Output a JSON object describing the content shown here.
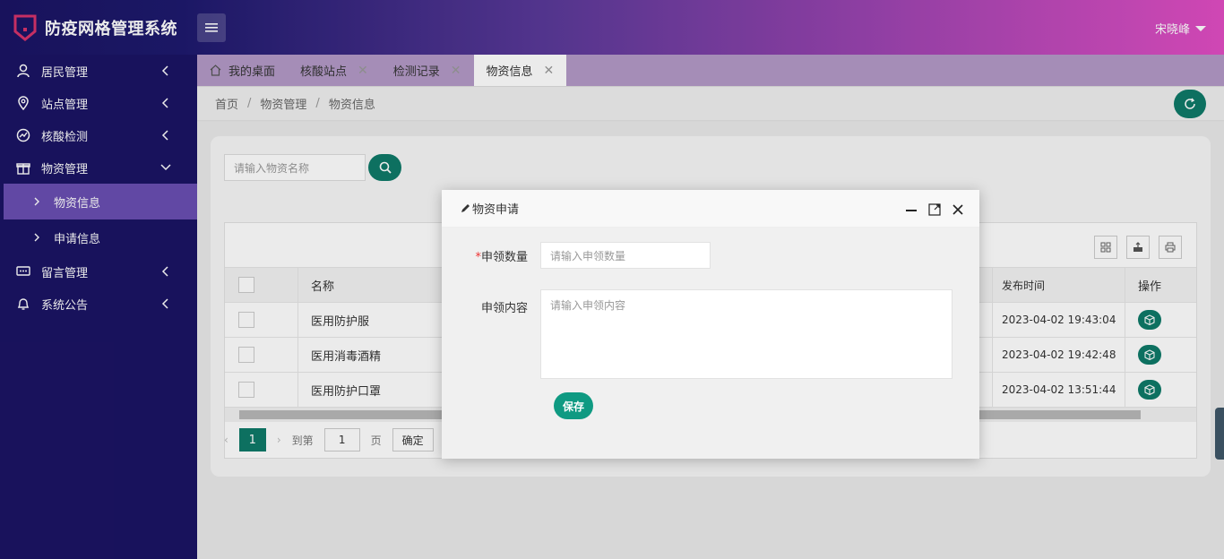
{
  "app": {
    "title": "防疫网格管理系统",
    "user": "宋晓峰"
  },
  "colors": {
    "primary": "#0f7a69",
    "sidebar": "#1b1464",
    "active_menu": "#6a4fb2"
  },
  "sidebar": {
    "items": [
      {
        "label": "居民管理",
        "icon": "user-icon"
      },
      {
        "label": "站点管理",
        "icon": "location-icon"
      },
      {
        "label": "核酸检测",
        "icon": "chart-icon"
      },
      {
        "label": "物资管理",
        "icon": "gift-icon"
      },
      {
        "label": "留言管理",
        "icon": "message-icon"
      },
      {
        "label": "系统公告",
        "icon": "bell-icon"
      }
    ],
    "sub_items": [
      {
        "label": "物资信息"
      },
      {
        "label": "申请信息"
      }
    ]
  },
  "tabs": [
    {
      "label": "我的桌面"
    },
    {
      "label": "核酸站点"
    },
    {
      "label": "检测记录"
    },
    {
      "label": "物资信息"
    }
  ],
  "breadcrumb": [
    "首页",
    "物资管理",
    "物资信息"
  ],
  "search": {
    "placeholder": "请输入物资名称"
  },
  "table": {
    "headers": {
      "name": "名称",
      "time": "发布时间",
      "op": "操作"
    },
    "rows": [
      {
        "name": "医用防护服",
        "time": "2023-04-02 19:43:04"
      },
      {
        "name": "医用消毒酒精",
        "time": "2023-04-02 19:42:48"
      },
      {
        "name": "医用防护口罩",
        "time": "2023-04-02 13:51:44"
      }
    ]
  },
  "pager": {
    "current": "1",
    "goto_label": "到第",
    "page_value": "1",
    "page_label": "页",
    "confirm": "确定"
  },
  "dialog": {
    "title": "物资申请",
    "qty_label": "申领数量",
    "qty_placeholder": "请输入申领数量",
    "content_label": "申领内容",
    "content_placeholder": "请输入申领内容",
    "save": "保存"
  }
}
